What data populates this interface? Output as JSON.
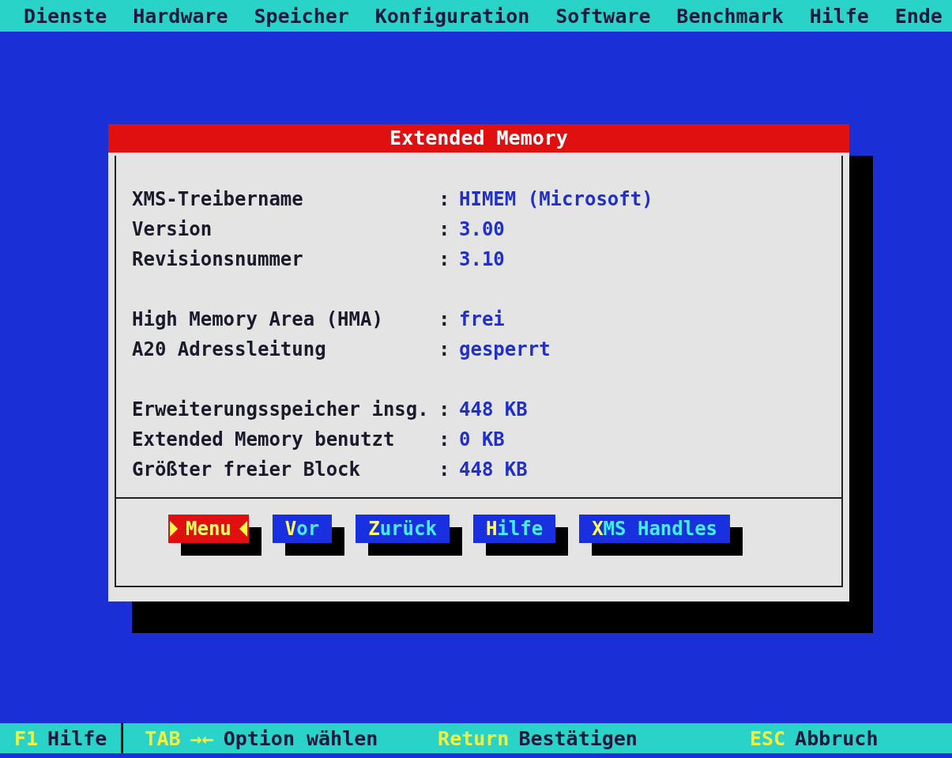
{
  "menu_bar": [
    "Dienste",
    "Hardware",
    "Speicher",
    "Konfiguration",
    "Software",
    "Benchmark",
    "Hilfe",
    "Ende"
  ],
  "dialog": {
    "title": "Extended Memory",
    "groups": [
      {
        "rows": [
          {
            "label": "XMS-Treibername",
            "separator": ":",
            "value": "HIMEM (Microsoft)"
          },
          {
            "label": "Version",
            "separator": ":",
            "value": "3.00"
          },
          {
            "label": "Revisionsnummer",
            "separator": ":",
            "value": "3.10"
          }
        ]
      },
      {
        "rows": [
          {
            "label": "High Memory Area (HMA)",
            "separator": ":",
            "value": "frei"
          },
          {
            "label": "A20 Adressleitung",
            "separator": ":",
            "value": "gesperrt"
          }
        ]
      },
      {
        "rows": [
          {
            "label": "Erweiterungsspeicher insg.",
            "separator": ":",
            "value": "448 KB"
          },
          {
            "label": "Extended Memory benutzt",
            "separator": ":",
            "value": "0 KB"
          },
          {
            "label": "Größter freier Block",
            "separator": ":",
            "value": "448 KB"
          }
        ]
      }
    ],
    "buttons": [
      {
        "label": "Menu",
        "selected": true
      },
      {
        "label": "Vor",
        "selected": false
      },
      {
        "label": "Zurück",
        "selected": false
      },
      {
        "label": "Hilfe",
        "selected": false
      },
      {
        "label": "XMS Handles",
        "selected": false
      }
    ]
  },
  "status_bar": [
    {
      "key": "F1",
      "label": "Hilfe"
    },
    {
      "key": "TAB",
      "symbol": "→←",
      "label": "Option wählen"
    },
    {
      "key": "Return",
      "label": "Bestätigen"
    },
    {
      "key": "ESC",
      "label": "Abbruch"
    }
  ]
}
